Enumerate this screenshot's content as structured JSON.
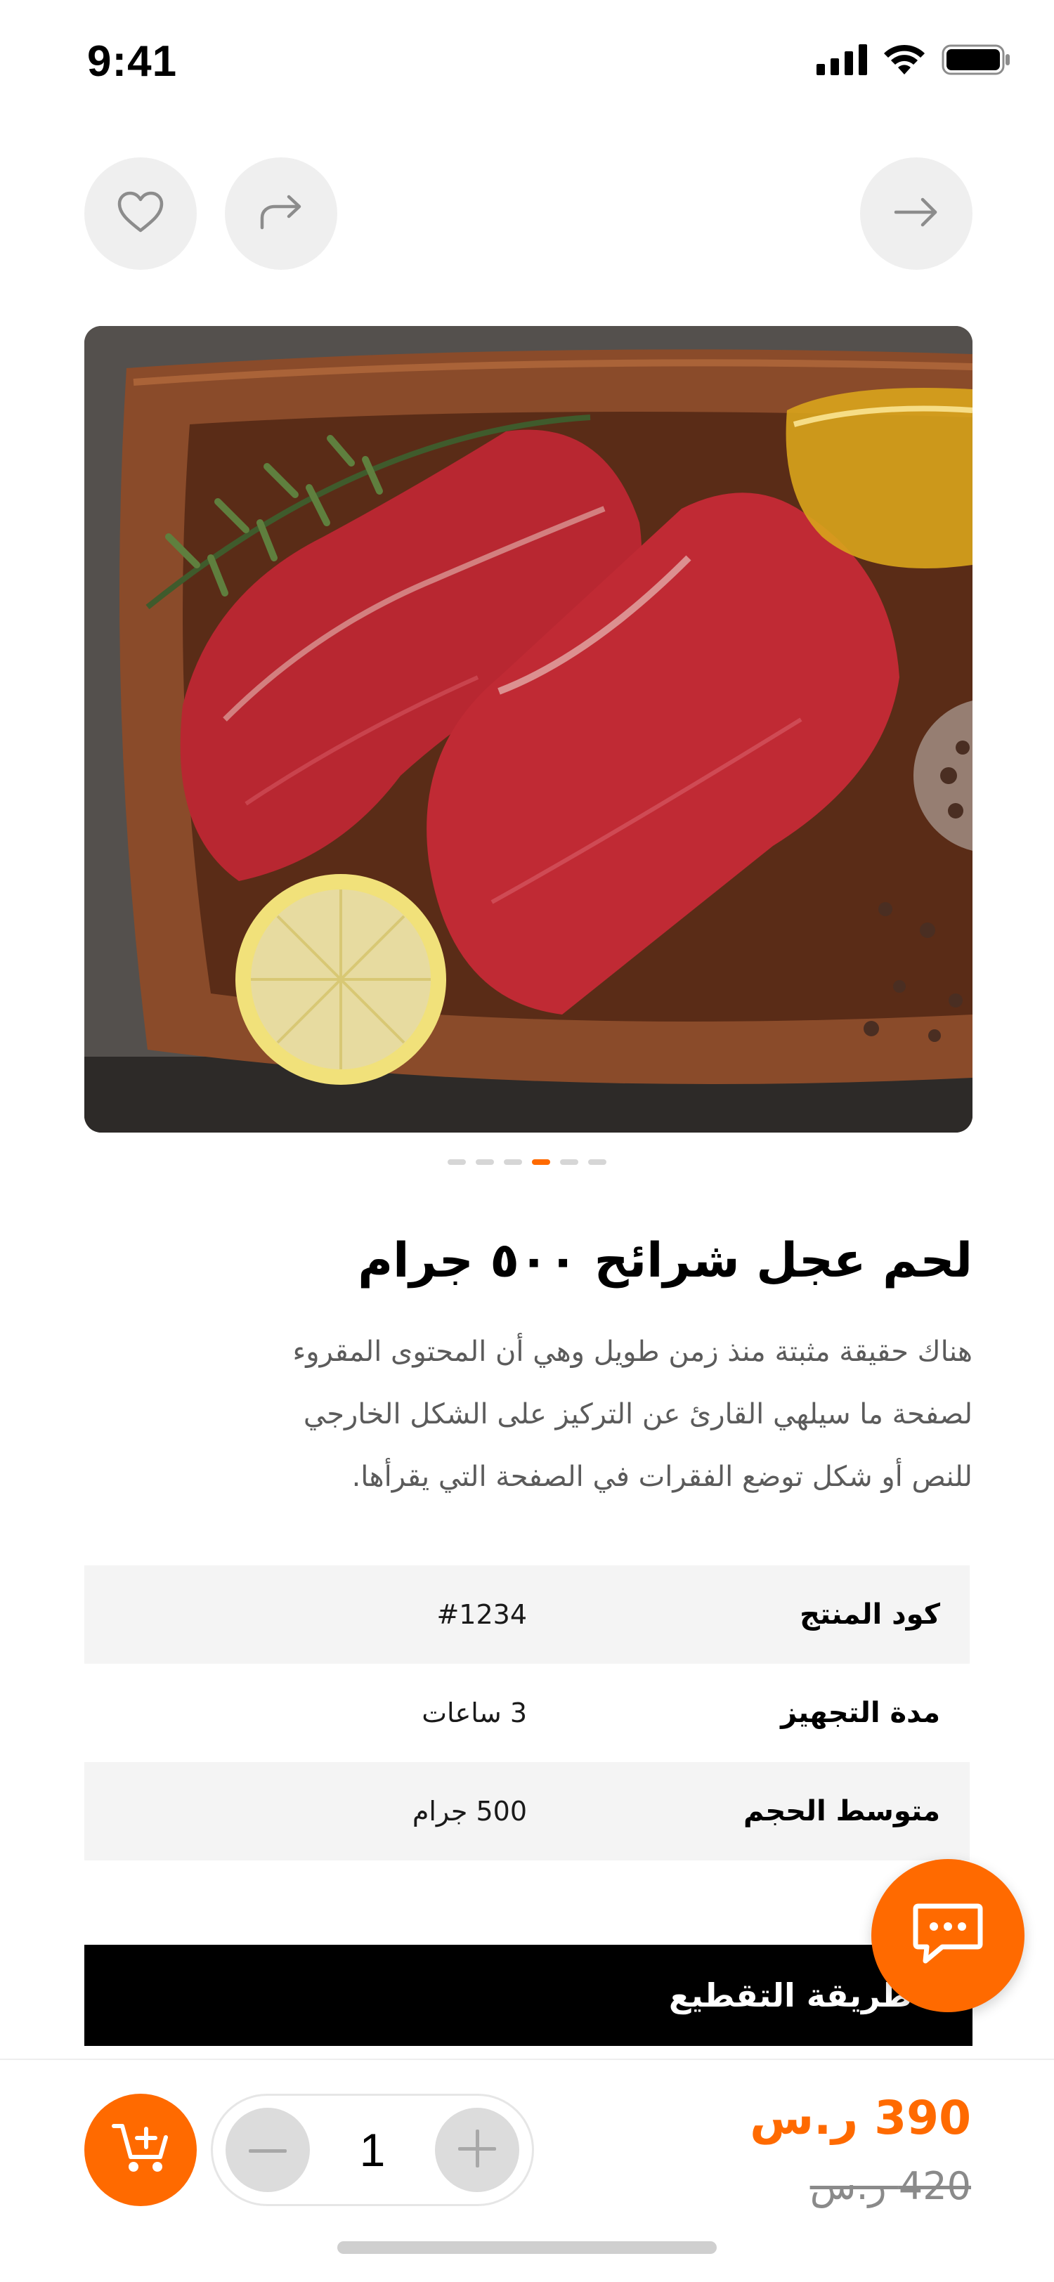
{
  "status_bar": {
    "time": "9:41",
    "icons": [
      "cellular-signal-icon",
      "wifi-icon",
      "battery-icon"
    ]
  },
  "top_actions": {
    "favorite_icon": "heart-icon",
    "share_icon": "share-icon",
    "back_icon": "arrow-right-icon"
  },
  "gallery": {
    "image_count": 6,
    "active_index": 3,
    "accent_color": "#ff6a00"
  },
  "product": {
    "title": "لحم عجل شرائح ٥٠٠ جرام",
    "description_lines": [
      "هناك حقيقة مثبتة منذ زمن طويل وهي أن المحتوى المقروء",
      "لصفحة ما سيلهي القارئ عن التركيز على الشكل الخارجي",
      "للنص أو شكل توضع الفقرات في الصفحة التي يقرأها."
    ]
  },
  "specs": [
    {
      "label": "كود المنتج",
      "value": "#1234"
    },
    {
      "label": "مدة التجهيز",
      "value": "3 ساعات"
    },
    {
      "label": "متوسط الحجم",
      "value": "500 جرام"
    }
  ],
  "cutting": {
    "label": "طريقة التقطيع"
  },
  "chat": {
    "icon": "chat-bubble-icon",
    "color": "#ff6a00"
  },
  "cart": {
    "icon": "add-to-cart-icon",
    "quantity": "1",
    "price_new": "390 ر.س",
    "price_old": "420 ر.س"
  }
}
